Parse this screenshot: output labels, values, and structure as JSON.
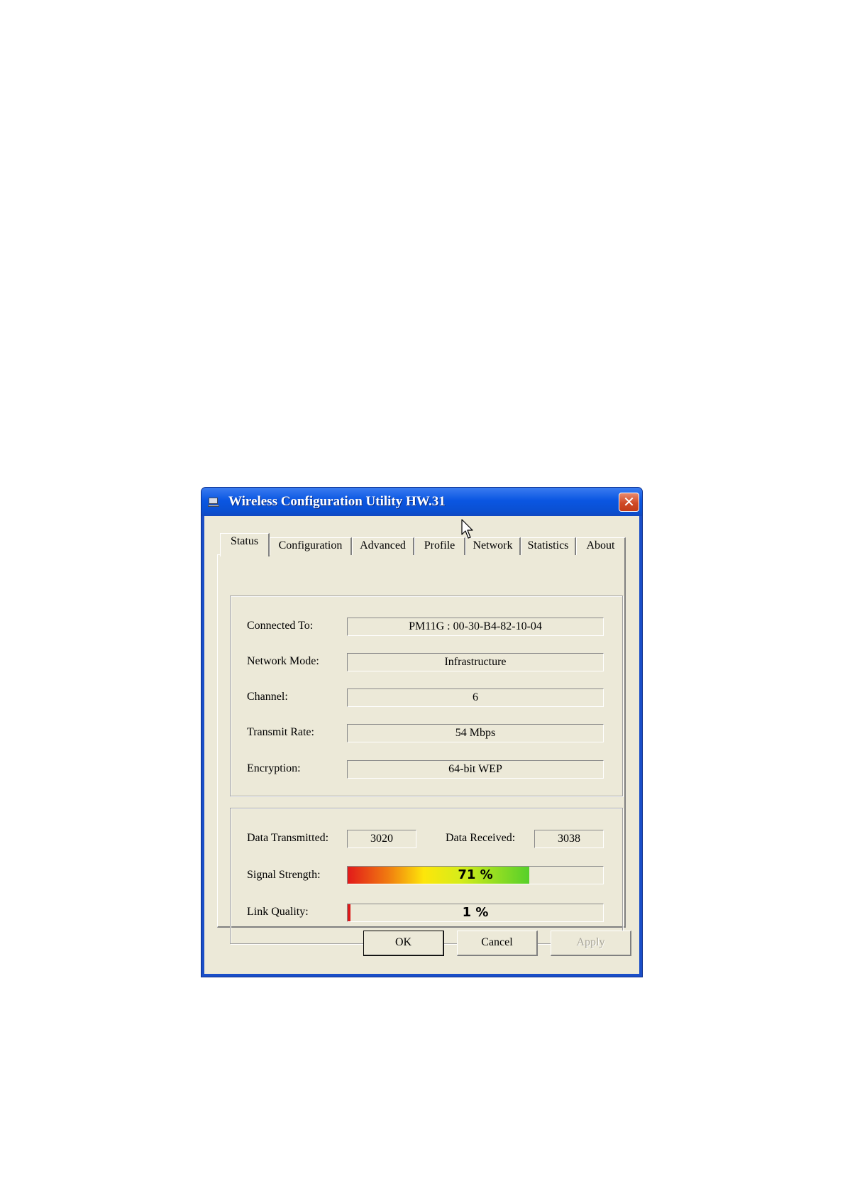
{
  "window": {
    "title": "Wireless Configuration Utility HW.31",
    "close_symbol": "✕"
  },
  "tabs": [
    {
      "label": "Status",
      "active": true
    },
    {
      "label": "Configuration",
      "active": false
    },
    {
      "label": "Advanced",
      "active": false
    },
    {
      "label": "Profile",
      "active": false
    },
    {
      "label": "Network",
      "active": false
    },
    {
      "label": "Statistics",
      "active": false
    },
    {
      "label": "About",
      "active": false
    }
  ],
  "status": {
    "connected_to_label": "Connected To:",
    "connected_to_value": "PM11G : 00-30-B4-82-10-04",
    "network_mode_label": "Network Mode:",
    "network_mode_value": "Infrastructure",
    "channel_label": "Channel:",
    "channel_value": "6",
    "transmit_rate_label": "Transmit Rate:",
    "transmit_rate_value": "54 Mbps",
    "encryption_label": "Encryption:",
    "encryption_value": "64-bit WEP"
  },
  "stats": {
    "data_transmitted_label": "Data Transmitted:",
    "data_transmitted_value": "3020",
    "data_received_label": "Data Received:",
    "data_received_value": "3038",
    "signal_strength_label": "Signal Strength:",
    "signal_strength_text": "71 %",
    "signal_strength_percent": 71,
    "link_quality_label": "Link Quality:",
    "link_quality_text": "1 %",
    "link_quality_percent": 1
  },
  "buttons": {
    "ok": "OK",
    "cancel": "Cancel",
    "apply": "Apply"
  },
  "colors": {
    "titlebar": "#0a56e2",
    "dialog_face": "#ece9d8",
    "close_button": "#d04a26"
  },
  "icons": [
    "computer-icon",
    "close-icon",
    "mouse-cursor-icon"
  ]
}
